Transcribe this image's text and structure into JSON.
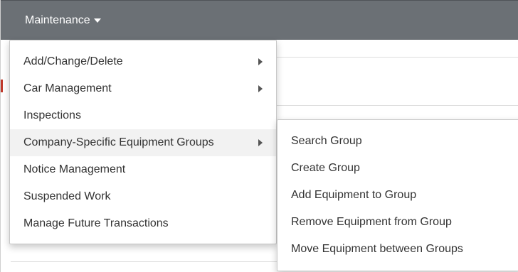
{
  "navbar": {
    "menu_label": "Maintenance"
  },
  "menu": {
    "items": [
      {
        "label": "Add/Change/Delete",
        "has_submenu": true
      },
      {
        "label": "Car Management",
        "has_submenu": true
      },
      {
        "label": "Inspections",
        "has_submenu": false
      },
      {
        "label": "Company-Specific Equipment Groups",
        "has_submenu": true,
        "active": true
      },
      {
        "label": "Notice Management",
        "has_submenu": false
      },
      {
        "label": "Suspended Work",
        "has_submenu": false
      },
      {
        "label": "Manage Future Transactions",
        "has_submenu": false
      }
    ]
  },
  "submenu": {
    "items": [
      {
        "label": "Search Group"
      },
      {
        "label": "Create Group"
      },
      {
        "label": "Add Equipment to Group"
      },
      {
        "label": "Remove Equipment from Group"
      },
      {
        "label": "Move Equipment between Groups"
      }
    ]
  },
  "colors": {
    "navbar_bg": "#6b7075",
    "active_item_bg": "#f2f2f2",
    "accent_red": "#c0392b"
  },
  "icons": {
    "dropdown": "caret-down-icon",
    "submenu": "caret-right-icon"
  }
}
